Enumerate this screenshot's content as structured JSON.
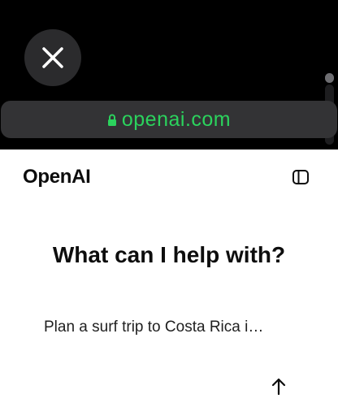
{
  "browser": {
    "url": "openai.com",
    "accent_color": "#2bd35d",
    "close_icon": "close-icon",
    "lock_icon": "lock-icon"
  },
  "page": {
    "logo": "OpenAI",
    "sidebar_icon": "sidebar-toggle-icon",
    "headline": "What can I help with?",
    "prompt_text": "Plan a surf trip to Costa Rica i…",
    "send_icon": "arrow-up-icon"
  }
}
